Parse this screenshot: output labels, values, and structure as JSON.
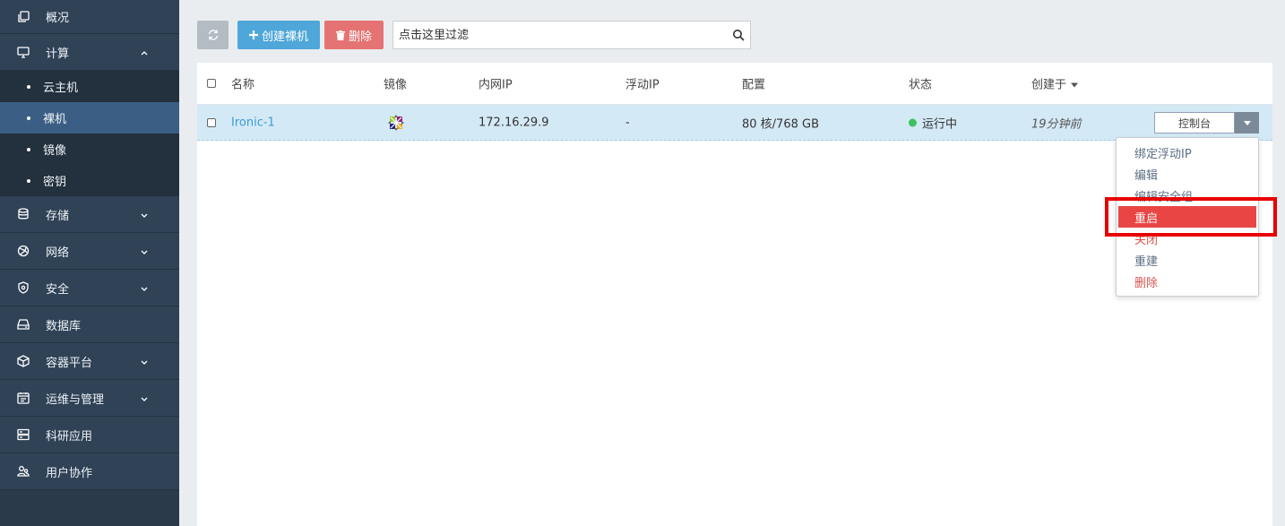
{
  "sidebar": {
    "items": [
      {
        "label": "概况",
        "icon": "copy-icon",
        "expandable": false
      },
      {
        "label": "计算",
        "icon": "monitor-icon",
        "expandable": true,
        "expanded": true,
        "children": [
          {
            "label": "云主机",
            "active": false
          },
          {
            "label": "裸机",
            "active": true
          },
          {
            "label": "镜像",
            "active": false
          },
          {
            "label": "密钥",
            "active": false
          }
        ]
      },
      {
        "label": "存储",
        "icon": "database-icon",
        "expandable": true
      },
      {
        "label": "网络",
        "icon": "globe-icon",
        "expandable": true
      },
      {
        "label": "安全",
        "icon": "shield-icon",
        "expandable": true
      },
      {
        "label": "数据库",
        "icon": "drive-icon",
        "expandable": false
      },
      {
        "label": "容器平台",
        "icon": "cube-icon",
        "expandable": true
      },
      {
        "label": "运维与管理",
        "icon": "calendar-icon",
        "expandable": true
      },
      {
        "label": "科研应用",
        "icon": "server-icon",
        "expandable": false
      },
      {
        "label": "用户协作",
        "icon": "users-icon",
        "expandable": false
      }
    ]
  },
  "toolbar": {
    "refresh_icon": "refresh-icon",
    "create_label": "创建裸机",
    "delete_label": "删除",
    "filter_placeholder": "点击这里过滤"
  },
  "table": {
    "headers": {
      "name": "名称",
      "image": "镜像",
      "private_ip": "内网IP",
      "floating_ip": "浮动IP",
      "config": "配置",
      "status": "状态",
      "created": "创建于"
    },
    "rows": [
      {
        "name": "Ironic-1",
        "image_icon": "centos-logo-icon",
        "private_ip": "172.16.29.9",
        "floating_ip": "-",
        "config": "80 核/768 GB",
        "status": "运行中",
        "status_color": "#3cc160",
        "created": "19分钟前",
        "console_label": "控制台"
      }
    ]
  },
  "dropdown": {
    "items": [
      {
        "label": "绑定浮动IP",
        "style": "normal"
      },
      {
        "label": "编辑",
        "style": "normal"
      },
      {
        "label": "编辑安全组",
        "style": "normal"
      },
      {
        "label": "重启",
        "style": "highlight"
      },
      {
        "label": "关闭",
        "style": "danger"
      },
      {
        "label": "重建",
        "style": "normal"
      },
      {
        "label": "删除",
        "style": "danger"
      }
    ]
  },
  "colors": {
    "sidebar_bg": "#2f4256",
    "active_sub": "#3b5e85",
    "primary": "#4fa6d9",
    "danger": "#e57373",
    "highlight_border": "#e80000"
  }
}
